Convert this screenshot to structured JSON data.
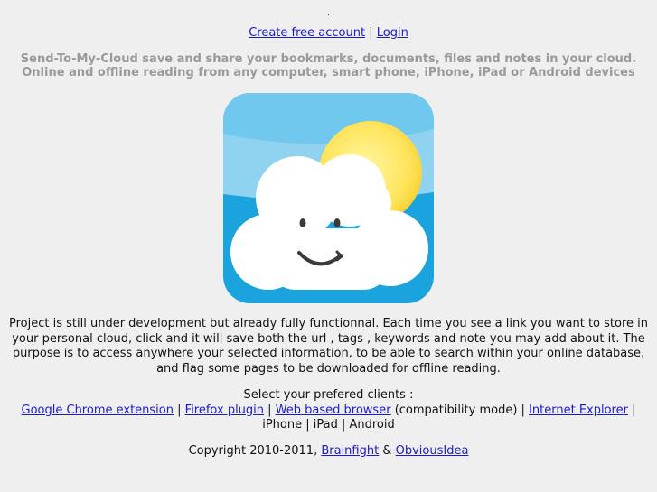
{
  "header": {
    "dot": ".",
    "create_account_label": "Create free account",
    "separator": " | ",
    "login_label": "Login"
  },
  "tagline": {
    "line1": "Send-To-My-Cloud save and share your bookmarks, documents, files and notes in your cloud.",
    "line2": "Online and offline reading from any computer, smart phone, iPhone, iPad or Android devices"
  },
  "logo": {
    "icon": "smiling-cloud-with-sun-icon",
    "colors": {
      "sky_top": "#8fd3f0",
      "sky_bottom": "#1aa3dd",
      "sun": "#ffe766",
      "cloud": "#ffffff",
      "face": "#3a3a3a"
    }
  },
  "description": {
    "text": "Project is still under development but already fully functionnal. Each time you see a link you want to store in your personal cloud, click and it will save both the url , tags , keywords and note you may add about it. The purpose is to access anywhere your selected information, to be able to search within your online database, and flag some pages to be downloaded for offline reading."
  },
  "clients": {
    "heading": "Select your prefered clients :",
    "chrome_label": "Google Chrome extension",
    "firefox_label": "Firefox plugin",
    "web_label": "Web based browser",
    "web_note": " (compatibility mode) | ",
    "ie_label": "Internet Explorer",
    "rest": " | iPhone | iPad | Android",
    "sep": " | "
  },
  "footer": {
    "prefix": "Copyright 2010-2011, ",
    "brainfight_label": "Brainfight",
    "amp": " & ",
    "obviousidea_label": "ObviousIdea"
  }
}
